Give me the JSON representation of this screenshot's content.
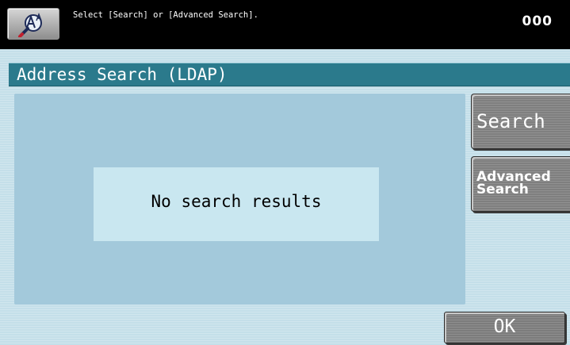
{
  "status_bar": {
    "message": "Select [Search] or [Advanced Search].",
    "counter": "000"
  },
  "screen": {
    "title": "Address Search (LDAP)"
  },
  "results": {
    "message": "No search results"
  },
  "buttons": {
    "search_label": "Search",
    "advanced_search_label": "Advanced\nSearch",
    "ok_label": "OK"
  },
  "icons": {
    "accessibility": "accessibility-icon"
  },
  "colors": {
    "title_bar": "#2b7a8c",
    "background": "#c4dfe9",
    "results_area": "#a3c9db",
    "message_box": "#c9e7f0",
    "button_gray": "#7f7f7f",
    "status_bar": "#000000"
  }
}
